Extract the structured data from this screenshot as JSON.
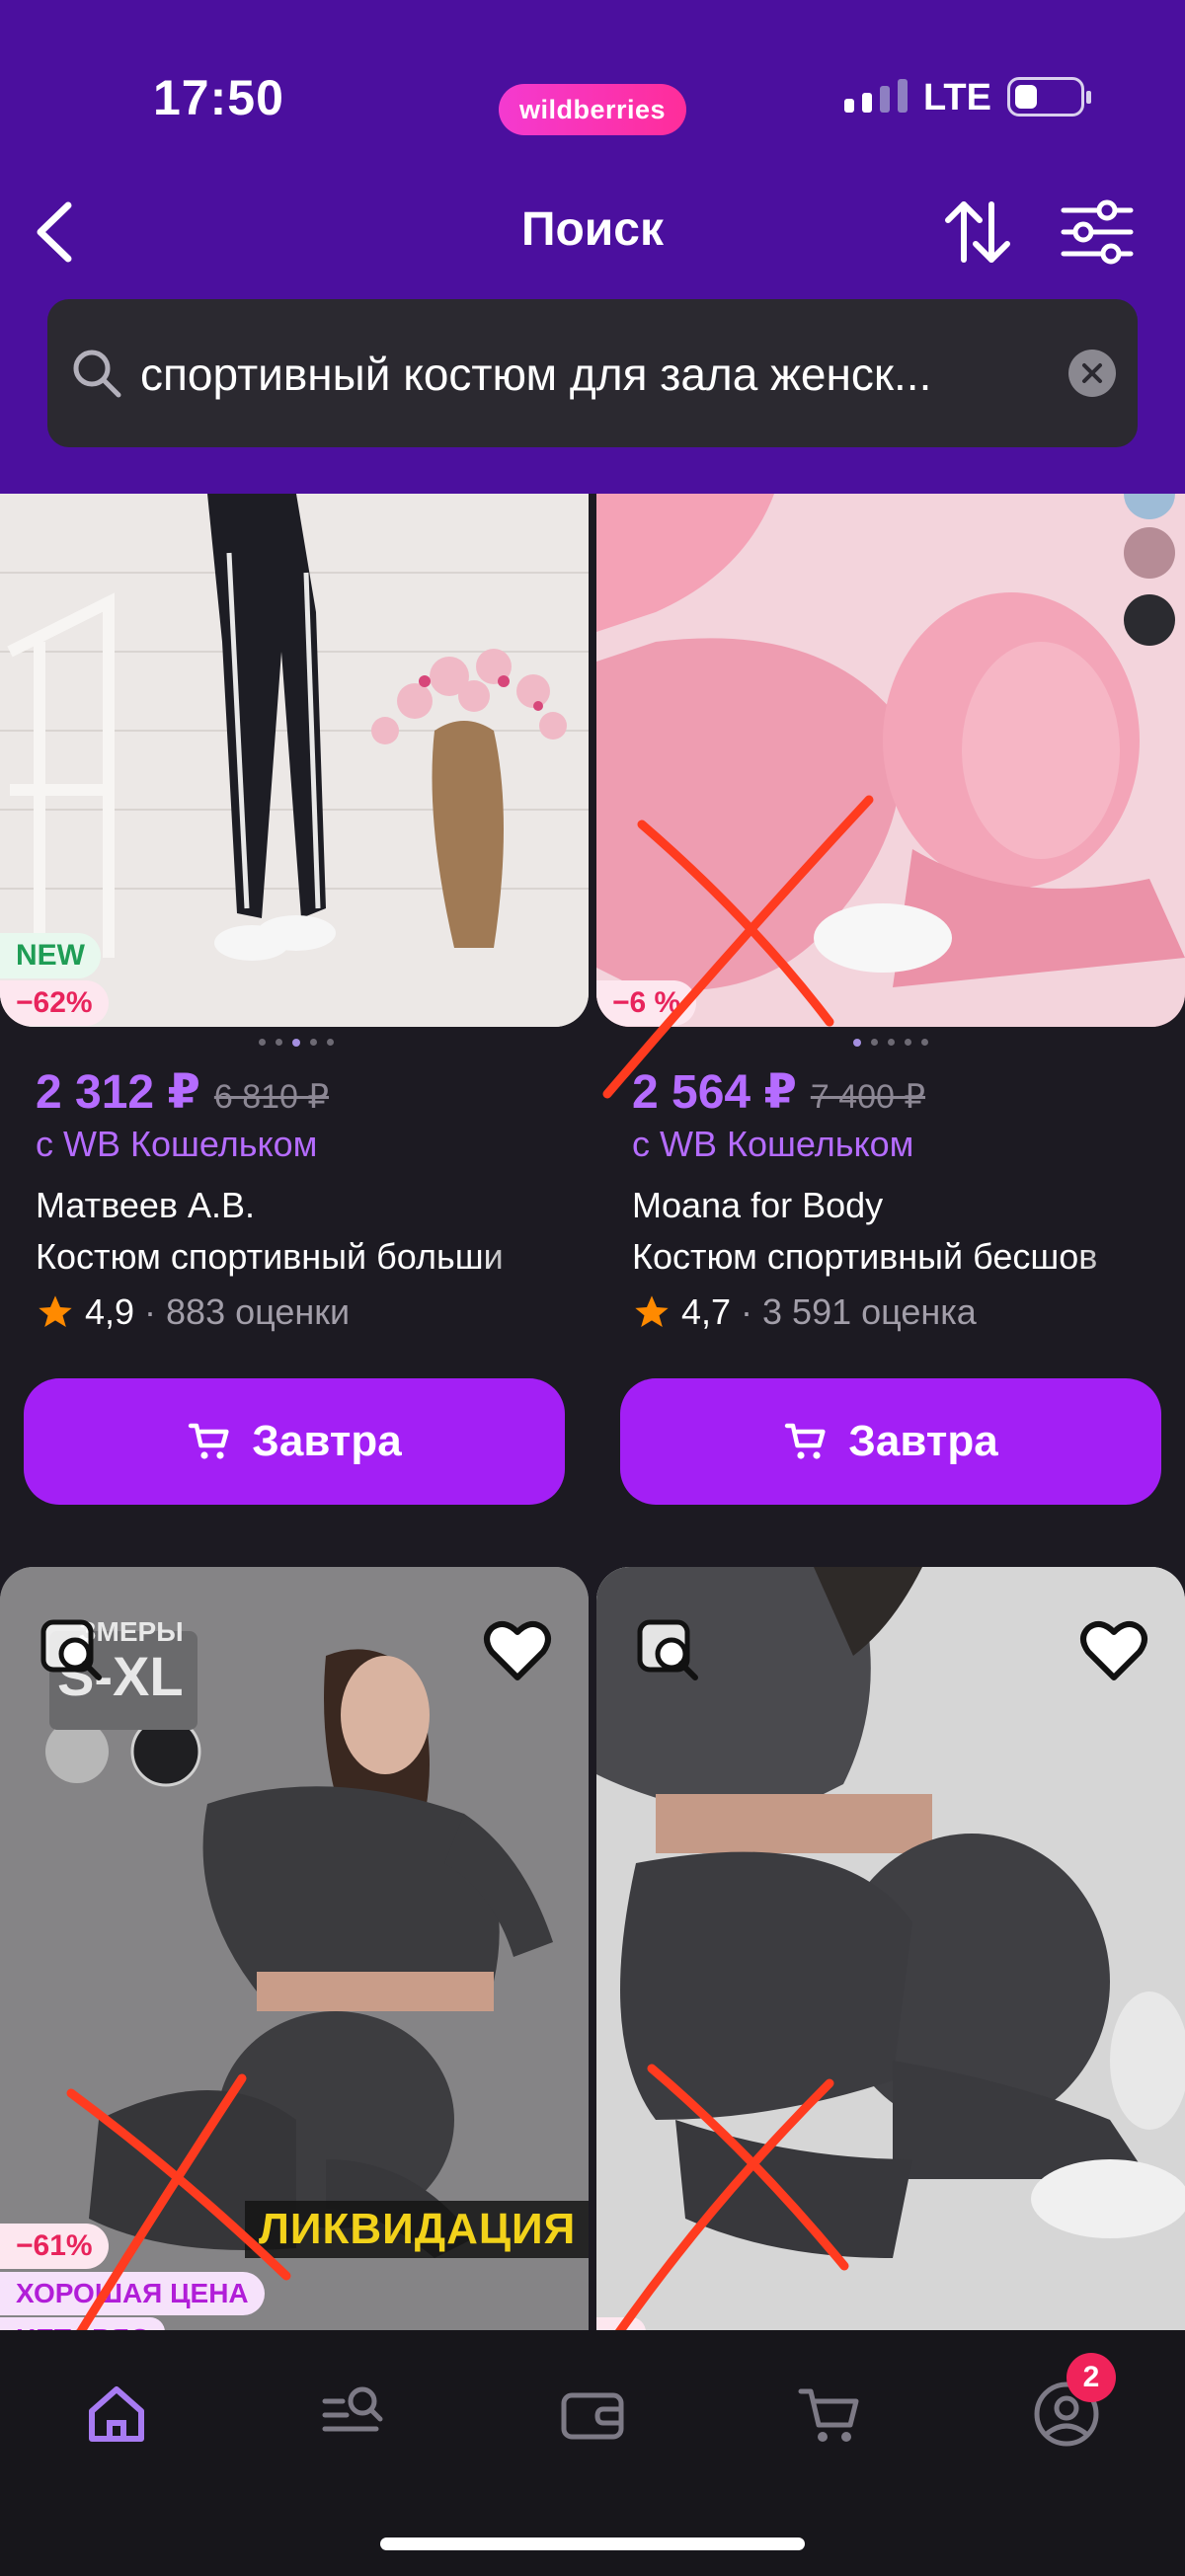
{
  "status_bar": {
    "time": "17:50",
    "brand_pill": "wildberries",
    "network": "LTE"
  },
  "header": {
    "title": "Поиск"
  },
  "search": {
    "value": "спортивный костюм для зала женск..."
  },
  "products": [
    {
      "badges": [
        "NEW",
        "−62%"
      ],
      "price": "2 312 ₽",
      "old_price": "6 810 ₽",
      "wallet_note": "с WB Кошельком",
      "brand": "Матвеев А.В.",
      "name": "Костюм спортивный больши",
      "rating": "4,9",
      "reviews": "· 883 оценки",
      "button": "Завтра"
    },
    {
      "badges": [
        "−6 %"
      ],
      "price": "2 564 ₽",
      "old_price": "7 400 ₽",
      "wallet_note": "с WB Кошельком",
      "brand": "Moana for Body",
      "name": "Костюм спортивный бесшов",
      "rating": "4,7",
      "reviews": "· 3 591 оценка",
      "button": "Завтра"
    },
    {
      "badges": [
        "−61%",
        "ХОРОШАЯ ЦЕНА"
      ],
      "image_text": {
        "sizes_label": "ЗМЕРЫ",
        "sizes_value": "S-XL",
        "promo": "ЛИКВИДАЦИЯ",
        "cutoff": "НЕТОРЯС"
      }
    },
    {
      "badges": [
        "−"
      ]
    }
  ],
  "tab_bar": {
    "cart_count": "2"
  },
  "colors": {
    "header_bg": "#4b0f9e",
    "accent": "#a31ff5",
    "price": "#b56cff",
    "background": "#1c1a22",
    "annotation": "#ff3b1f"
  }
}
